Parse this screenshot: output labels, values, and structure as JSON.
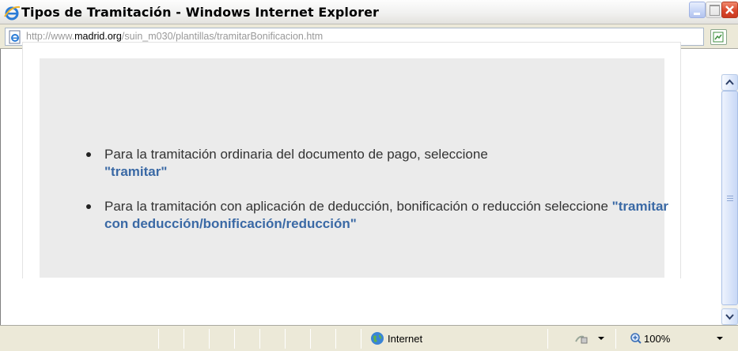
{
  "window": {
    "title": "Tipos de Tramitación - Windows Internet Explorer"
  },
  "address": {
    "url_prefix": "http://www.",
    "url_domain": "madrid.org",
    "url_path": "/suin_m030/plantillas/tramitarBonificacion.htm"
  },
  "content": {
    "items": [
      {
        "text": "Para la tramitación ordinaria del documento de pago, seleccione",
        "link": "\"tramitar\""
      },
      {
        "text": "Para la tramitación con aplicación de deducción, bonificación o reducción seleccione",
        "link": "\"tramitar con deducción/bonificación/reducción\""
      }
    ]
  },
  "status": {
    "zone": "Internet",
    "zoom": "100%"
  },
  "icons": {
    "browser": "ie-logo-icon",
    "page": "page-icon",
    "feed": "feed-icon",
    "zone": "globe-icon",
    "protected_mode": "protected-mode-icon",
    "zoom": "zoom-icon"
  }
}
